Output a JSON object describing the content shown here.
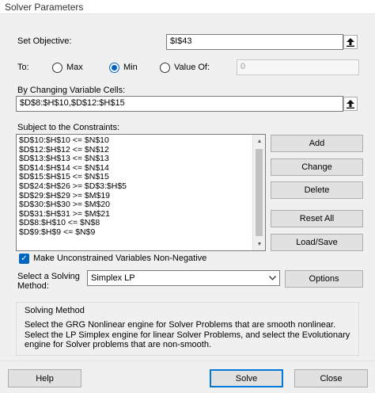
{
  "window": {
    "title": "Solver Parameters"
  },
  "objective": {
    "label": "Set Objective:",
    "value": "$I$43"
  },
  "to": {
    "label": "To:",
    "options": [
      {
        "label": "Max",
        "selected": false
      },
      {
        "label": "Min",
        "selected": true
      },
      {
        "label": "Value Of:",
        "selected": false
      }
    ],
    "value_of": "0"
  },
  "changing_cells": {
    "label": "By Changing Variable Cells:",
    "value": "$D$8:$H$10,$D$12:$H$15"
  },
  "constraints": {
    "label": "Subject to the Constraints:",
    "items": [
      "$D$10:$H$10 <= $N$10",
      "$D$12:$H$12 <= $N$12",
      "$D$13:$H$13 <= $N$13",
      "$D$14:$H$14 <= $N$14",
      "$D$15:$H$15 <= $N$15",
      "$D$24:$H$26 >= $D$3:$H$5",
      "$D$29:$H$29 >= $M$19",
      "$D$30:$H$30 >= $M$20",
      "$D$31:$H$31 >= $M$21",
      "$D$8:$H$10 <= $N$8",
      "$D$9:$H$9 <= $N$9"
    ]
  },
  "side_buttons": {
    "add": "Add",
    "change": "Change",
    "delete": "Delete",
    "reset_all": "Reset All",
    "load_save": "Load/Save"
  },
  "nonneg": {
    "label": "Make Unconstrained Variables Non-Negative",
    "checked": true
  },
  "method": {
    "label_line1": "Select a Solving",
    "label_line2": "Method:",
    "value": "Simplex LP",
    "options_button": "Options"
  },
  "solving_method": {
    "title": "Solving Method",
    "description": "Select the GRG Nonlinear engine for Solver Problems that are smooth nonlinear. Select the LP Simplex engine for linear Solver Problems, and select the Evolutionary engine for Solver problems that are non-smooth."
  },
  "footer": {
    "help": "Help",
    "solve": "Solve",
    "close": "Close"
  },
  "colors": {
    "accent": "#0067c0",
    "default_border": "#0078d7"
  }
}
